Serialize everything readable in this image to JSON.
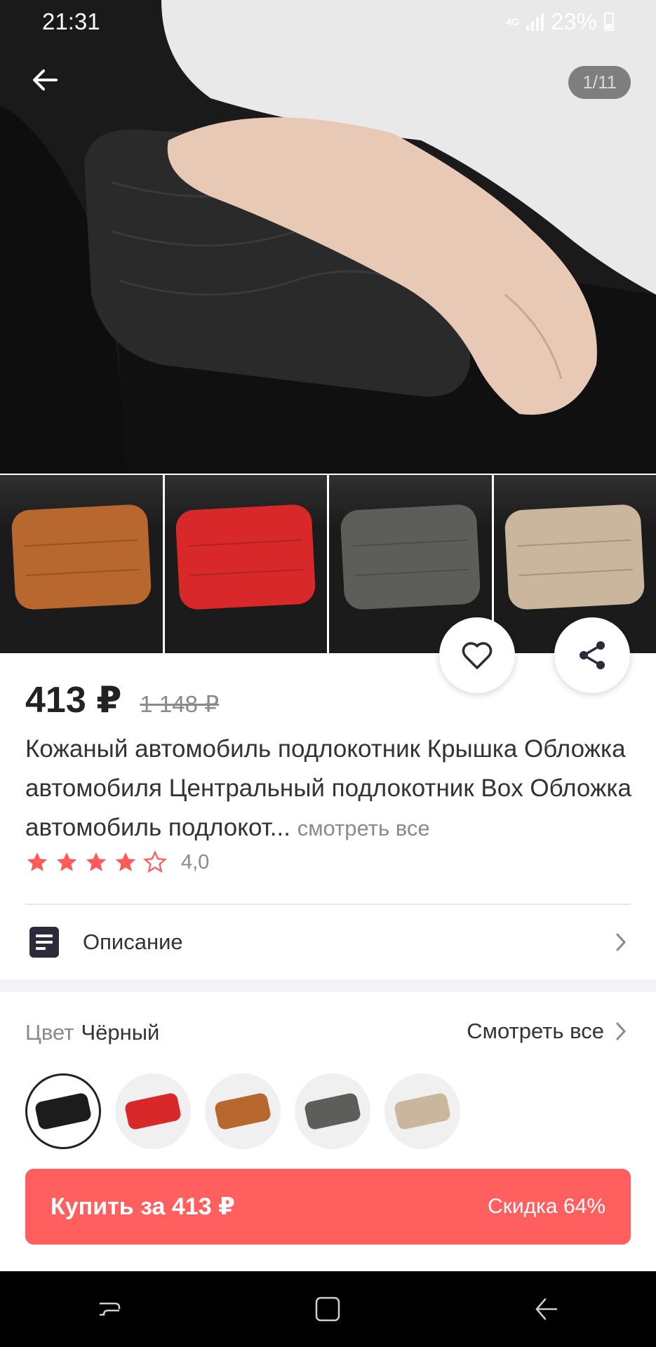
{
  "status_bar": {
    "time": "21:31",
    "network": "4G",
    "battery": "23%"
  },
  "gallery": {
    "counter": "1/11",
    "thumbnail_colors": [
      "#b8672e",
      "#d9282a",
      "#5d5d5a",
      "#c9b69c"
    ]
  },
  "product": {
    "price": "413 ₽",
    "old_price": "1 148 ₽",
    "title": "Кожаный автомобиль подлокотник Крышка Обложка автомобиля Центральный подлокотник Box Обложка автомобиль подлокот...",
    "see_more": "смотреть все",
    "rating_value": "4,0",
    "rating_stars": 4,
    "description_label": "Описание"
  },
  "color_selector": {
    "label": "Цвет",
    "selected": "Чёрный",
    "see_all": "Смотреть все",
    "swatches": [
      "#1c1c1c",
      "#d9282a",
      "#b8672e",
      "#5d5d5a",
      "#c9b69c"
    ]
  },
  "buy": {
    "label": "Купить за 413 ₽",
    "discount": "Скидка 64%"
  },
  "colors": {
    "accent": "#ff5f5f",
    "star": "#ff5a5a"
  }
}
